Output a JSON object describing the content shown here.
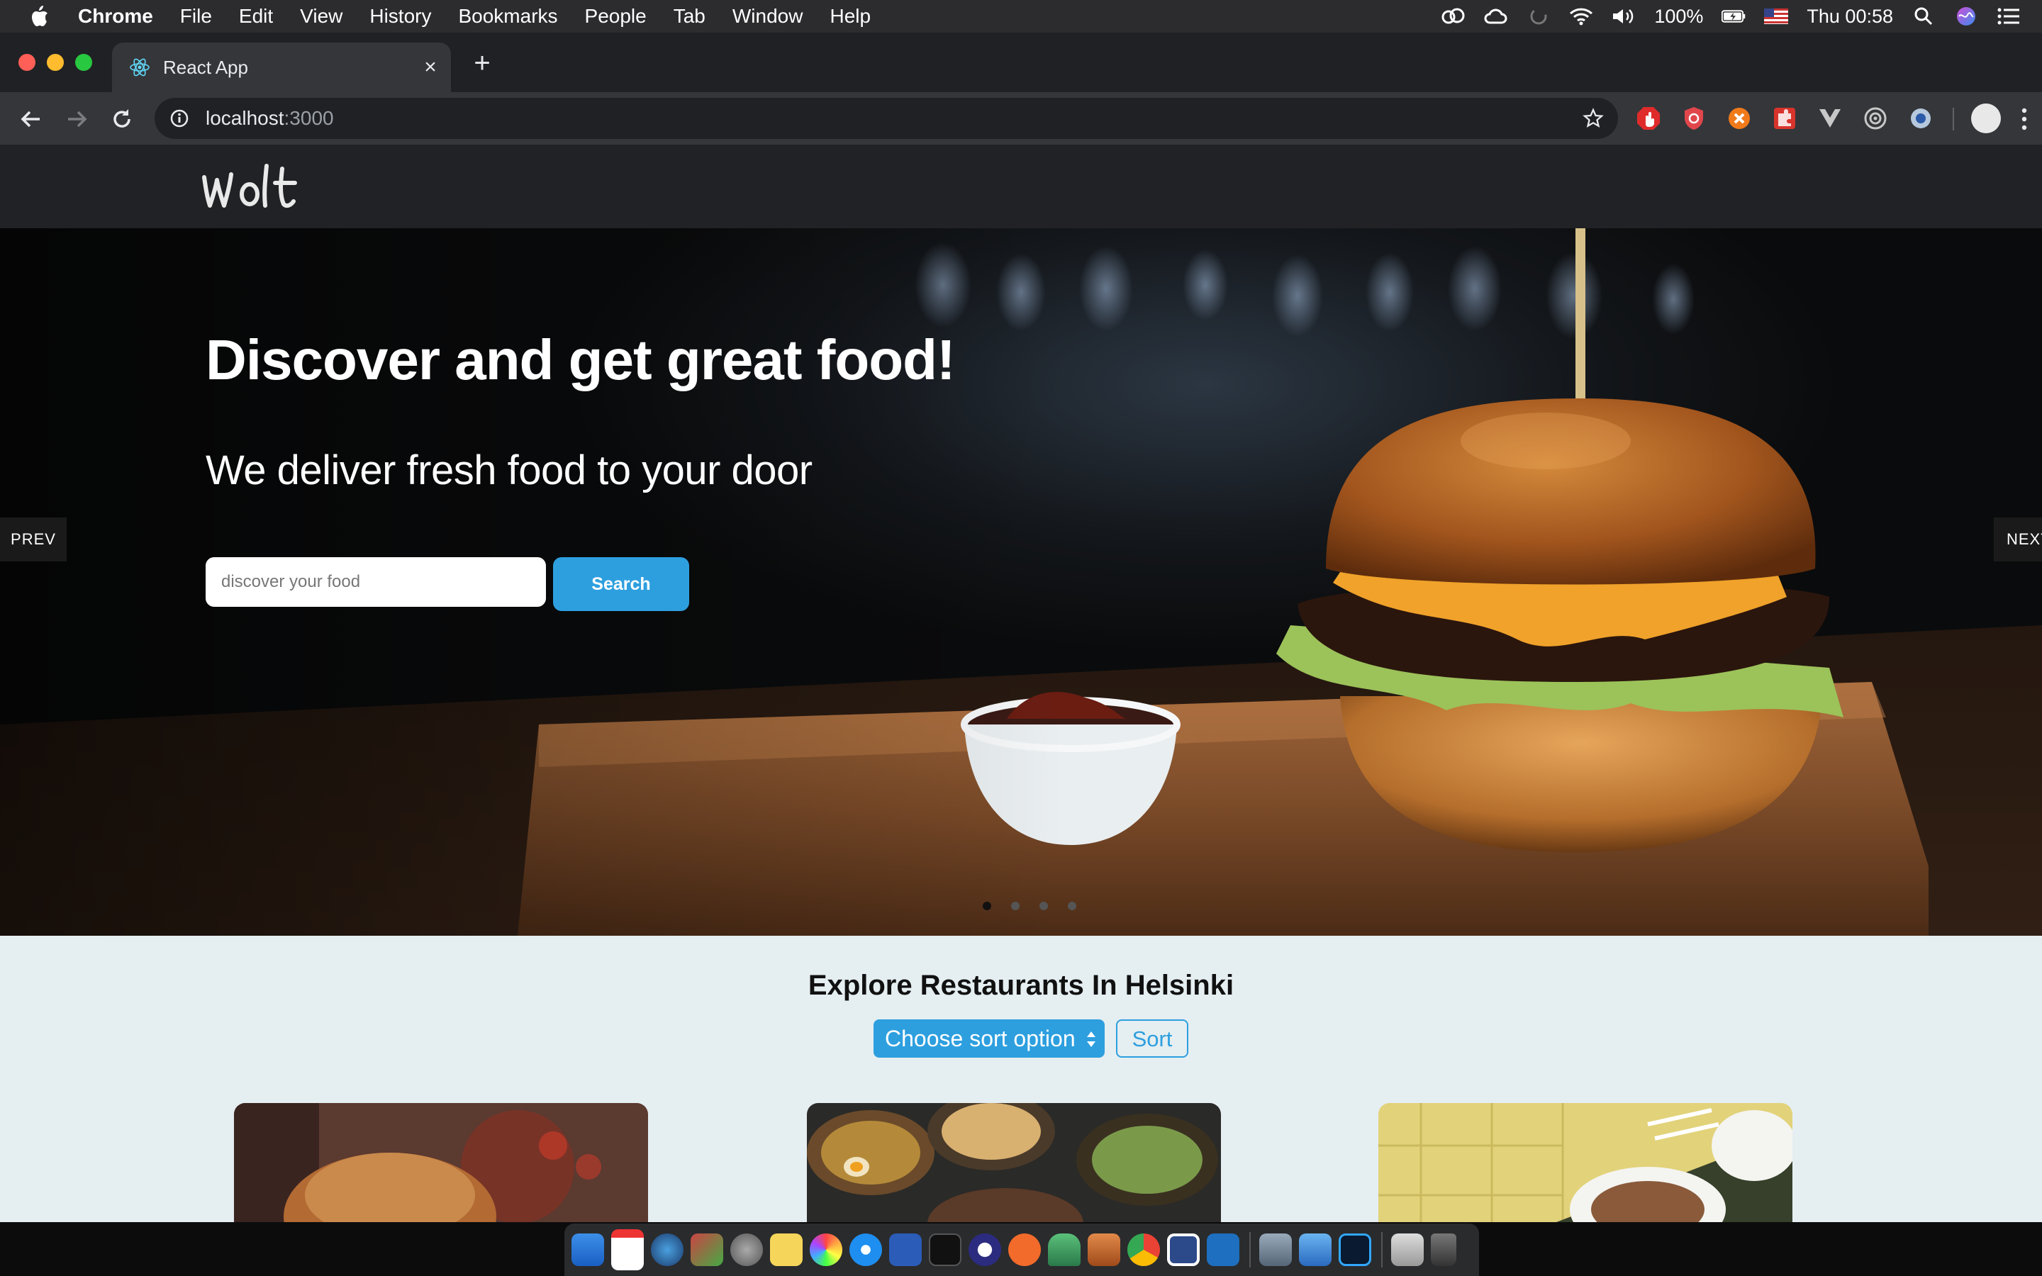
{
  "menubar": {
    "app_name": "Chrome",
    "items": [
      "File",
      "Edit",
      "View",
      "History",
      "Bookmarks",
      "People",
      "Tab",
      "Window",
      "Help"
    ],
    "battery": "100%",
    "clock": "Thu 00:58"
  },
  "browser": {
    "tab_title": "React App",
    "url_host": "localhost",
    "url_port": ":3000"
  },
  "hero": {
    "title": "Discover and get great food!",
    "subtitle": "We deliver fresh food to your door",
    "search_placeholder": "discover your food",
    "search_button": "Search",
    "prev_label": "PREV",
    "next_label": "NEXT",
    "slide_count": 4,
    "active_slide": 1
  },
  "explore": {
    "title": "Explore Restaurants In Helsinki",
    "sort_select": "Choose sort option",
    "sort_button": "Sort"
  },
  "colors": {
    "accent": "#2d9fdf",
    "header_bg": "#202225",
    "section_bg": "#e5eef1"
  }
}
